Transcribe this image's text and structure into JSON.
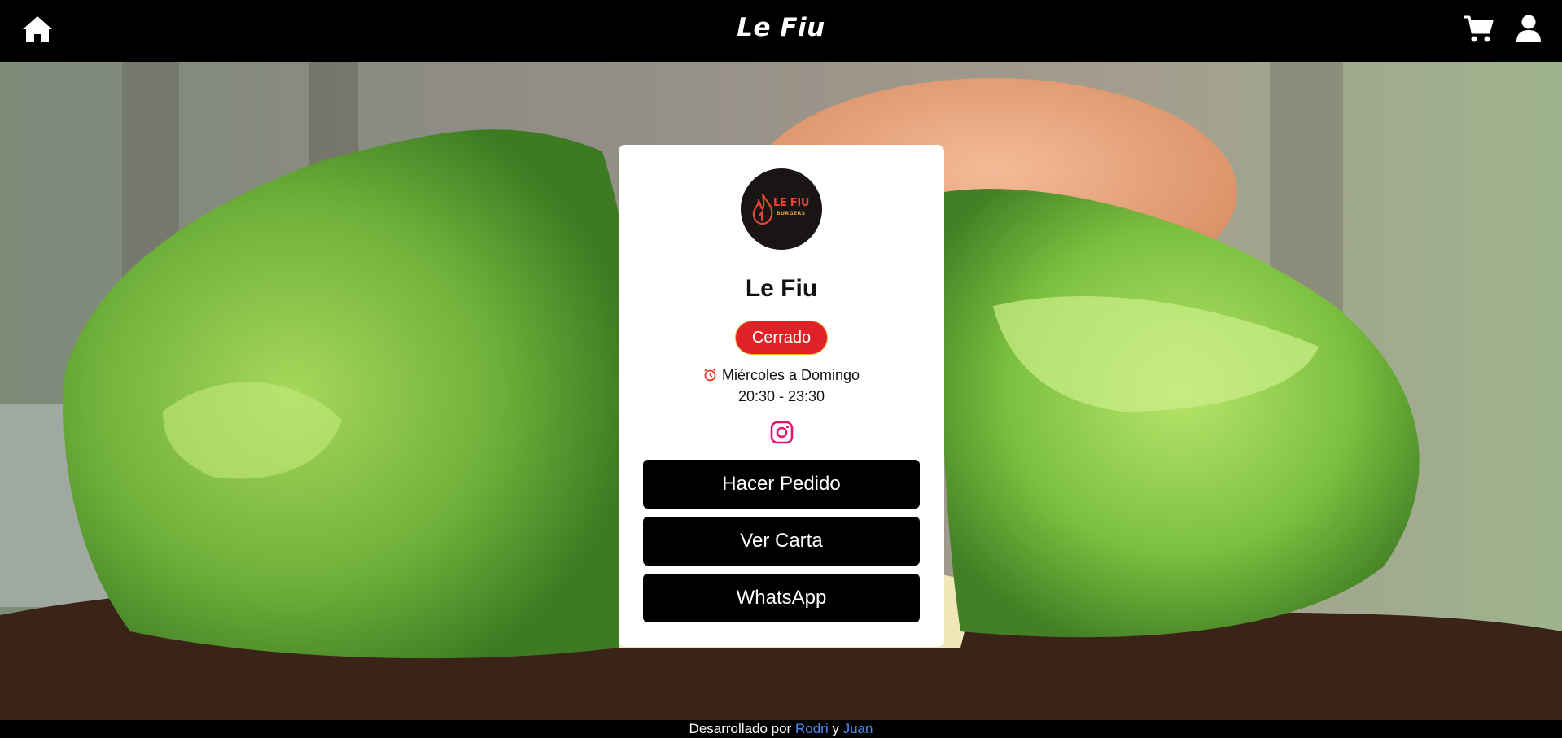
{
  "header": {
    "brand": "Le Fiu",
    "home_icon": "home-icon",
    "cart_icon": "cart-icon",
    "user_icon": "user-icon"
  },
  "card": {
    "logo": {
      "main": "LE FIU",
      "sub": "BURGERS"
    },
    "title": "Le Fiu",
    "status": "Cerrado",
    "status_color": "#de2227",
    "schedule_days": "Miércoles a Domingo",
    "schedule_time": "20:30 - 23:30",
    "instagram_icon": "instagram-icon",
    "buttons": {
      "order": "Hacer Pedido",
      "menu": "Ver Carta",
      "whatsapp": "WhatsApp"
    }
  },
  "footer": {
    "prefix": "Desarrollado por",
    "author1": "Rodri",
    "joiner": "y",
    "author2": "Juan"
  },
  "colors": {
    "link": "#4a8df0",
    "instagram": "#e4136f",
    "bar": "#000000"
  }
}
